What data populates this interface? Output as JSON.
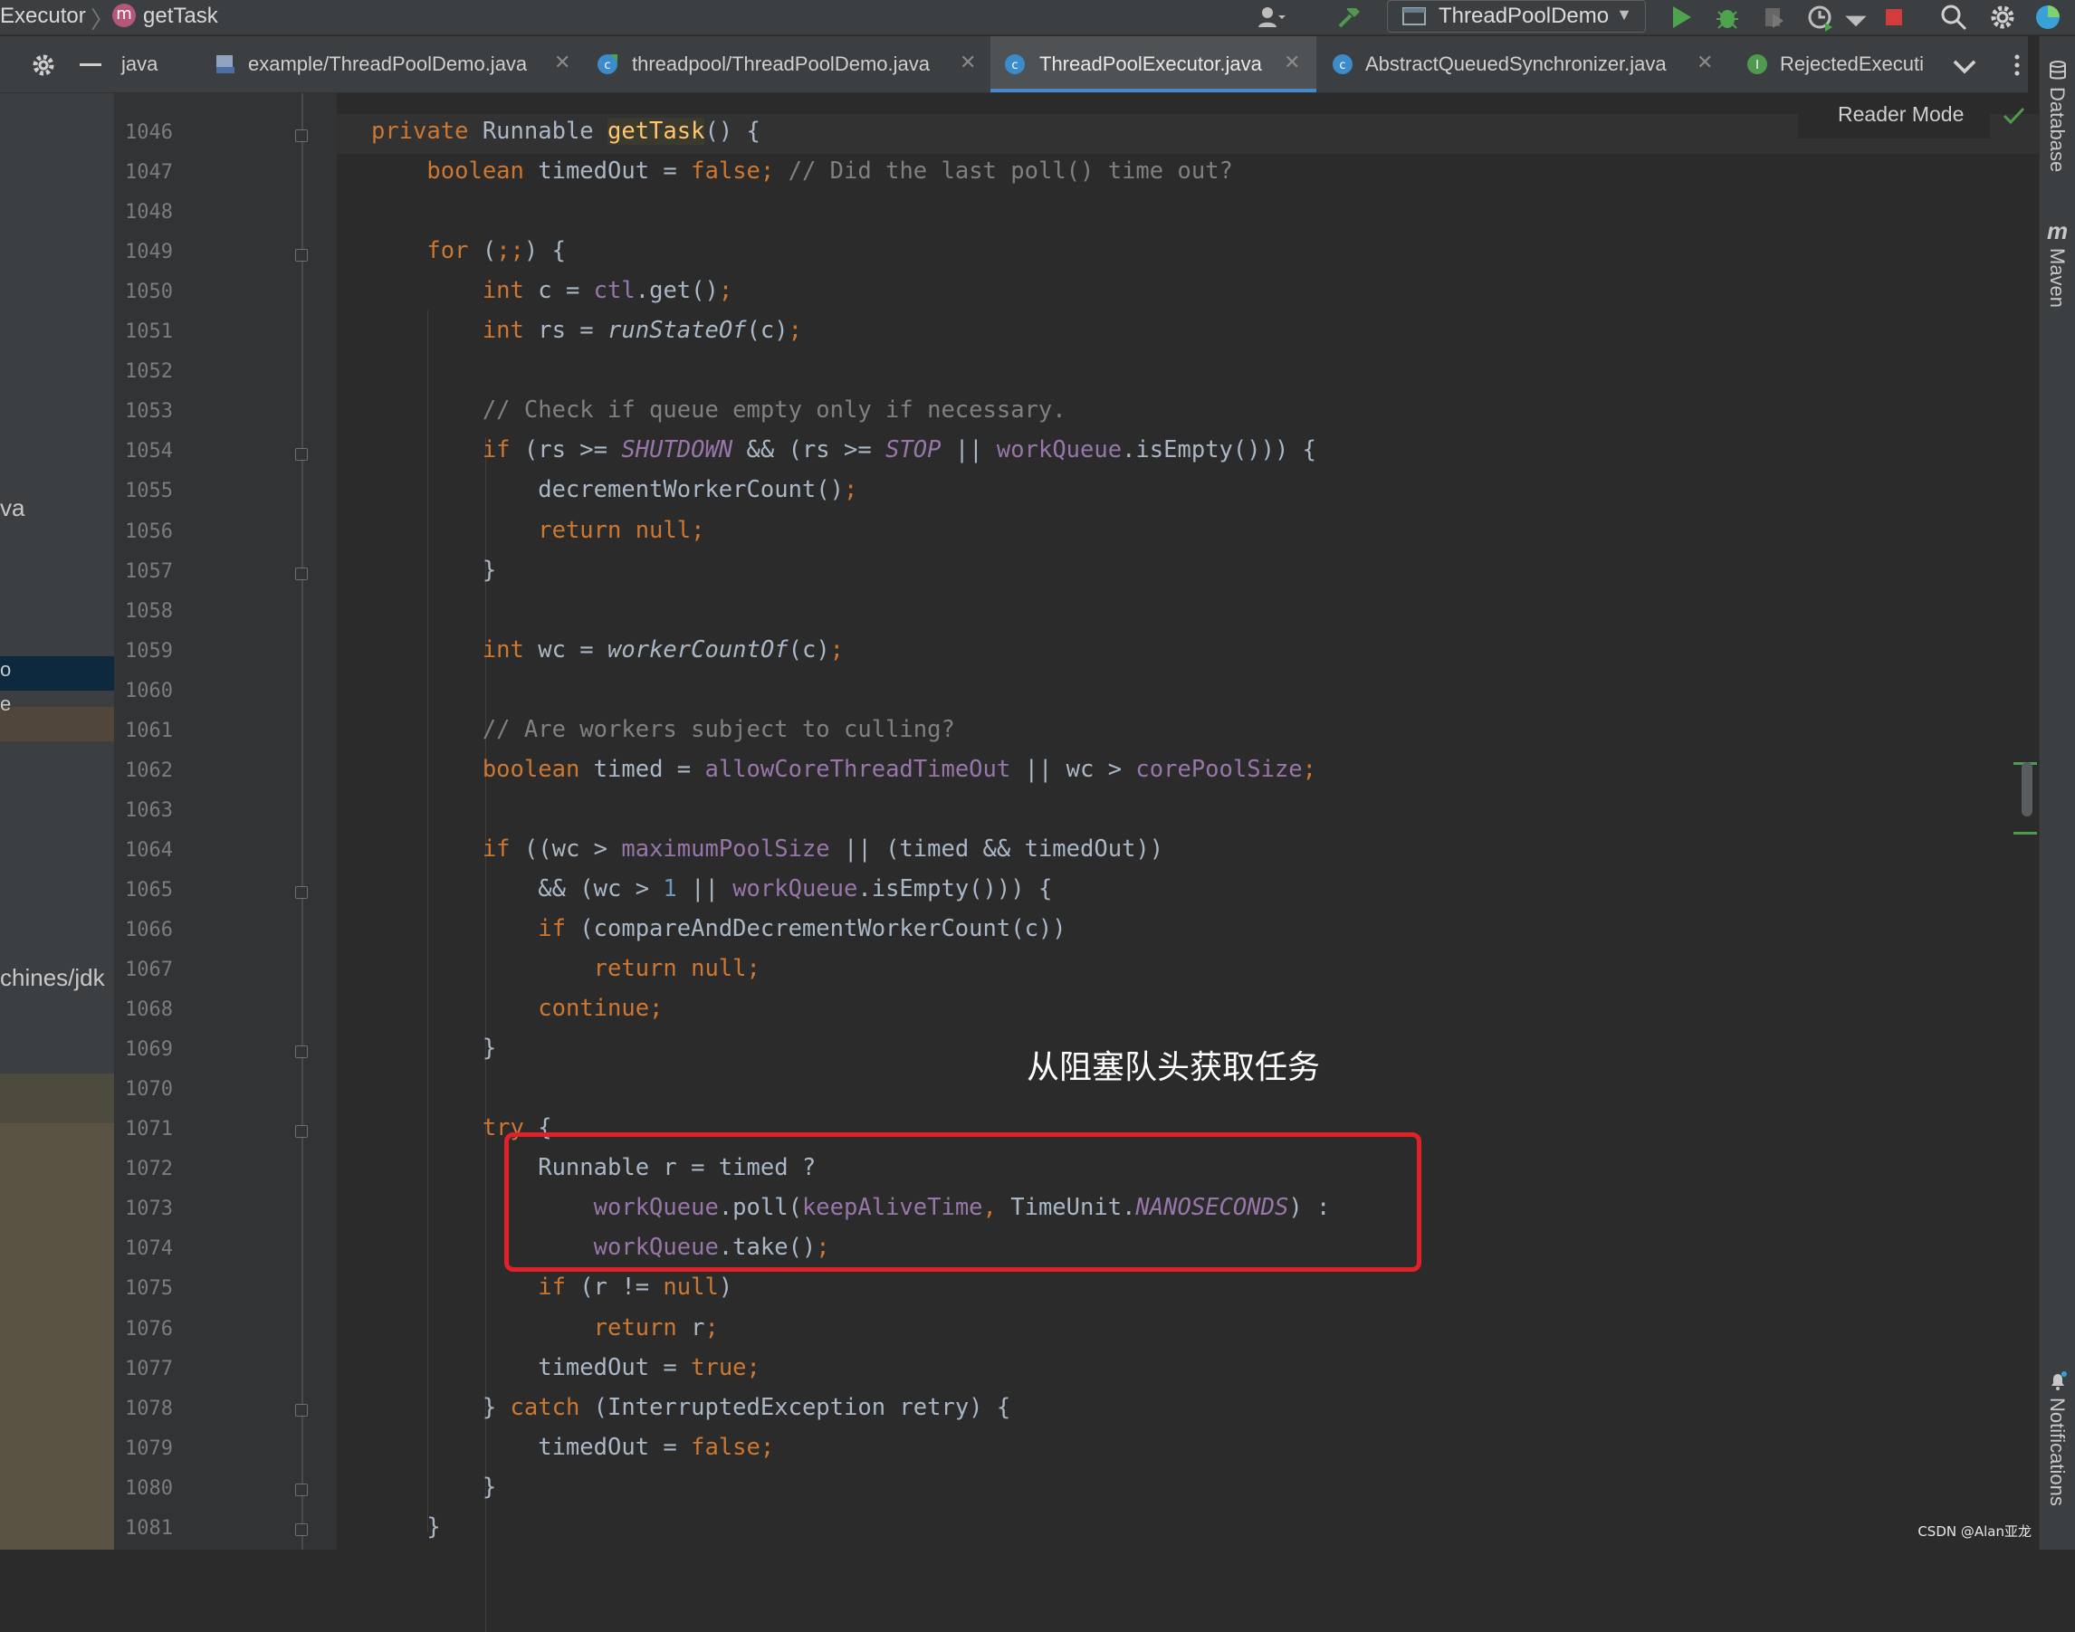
{
  "breadcrumb": {
    "class_name": "Executor",
    "method_badge": "m",
    "method_name": "getTask"
  },
  "toolbar": {
    "run_config": "ThreadPoolDemo"
  },
  "tabs": [
    {
      "label": "java"
    },
    {
      "label": "example/ThreadPoolDemo.java"
    },
    {
      "label": "threadpool/ThreadPoolDemo.java"
    },
    {
      "label": "ThreadPoolExecutor.java"
    },
    {
      "label": "AbstractQueuedSynchronizer.java"
    },
    {
      "label": "RejectedExecuti"
    }
  ],
  "active_tab": "ThreadPoolExecutor.java",
  "reader_mode": "Reader Mode",
  "left_panel": {
    "row1": "va",
    "row2": "o",
    "row3": "e",
    "row4": "chines/jdk"
  },
  "right_tools": {
    "database": "Database",
    "maven": "Maven",
    "notifications": "Notifications"
  },
  "annotation": "从阻塞队头获取任务",
  "watermark": "CSDN @Alan亚龙",
  "colors": {
    "keyword": "#cc7832",
    "field": "#9876aa",
    "method_decl": "#ffc66d",
    "comment": "#808080",
    "number": "#6897bb",
    "highlight_box": "#e0212a",
    "active_tab_underline": "#4a88c7"
  },
  "code": {
    "line_numbers": [
      "1046",
      "1047",
      "1048",
      "1049",
      "1050",
      "1051",
      "1052",
      "1053",
      "1054",
      "1055",
      "1056",
      "1057",
      "1058",
      "1059",
      "1060",
      "1061",
      "1062",
      "1063",
      "1064",
      "1065",
      "1066",
      "1067",
      "1068",
      "1069",
      "1070",
      "1071",
      "1072",
      "1073",
      "1074",
      "1075",
      "1076",
      "1077",
      "1078",
      "1079",
      "1080",
      "1081"
    ],
    "lines": [
      [
        {
          "t": "",
          "c": ""
        },
        {
          "t": "private ",
          "c": "kw"
        },
        {
          "t": "Runnable ",
          "c": ""
        },
        {
          "t": "getTask",
          "c": "meth"
        },
        {
          "t": "() {",
          "c": ""
        }
      ],
      [
        {
          "t": "    ",
          "c": ""
        },
        {
          "t": "boolean ",
          "c": "kw"
        },
        {
          "t": "timedOut = ",
          "c": ""
        },
        {
          "t": "false",
          "c": "kw"
        },
        {
          "t": "; ",
          "c": "kw"
        },
        {
          "t": "// Did the last poll() time out?",
          "c": "cmt"
        }
      ],
      [],
      [
        {
          "t": "    ",
          "c": ""
        },
        {
          "t": "for ",
          "c": "kw"
        },
        {
          "t": "(",
          "c": ""
        },
        {
          "t": ";;",
          "c": "kw"
        },
        {
          "t": ") {",
          "c": ""
        }
      ],
      [
        {
          "t": "        ",
          "c": ""
        },
        {
          "t": "int ",
          "c": "kw"
        },
        {
          "t": "c = ",
          "c": ""
        },
        {
          "t": "ctl",
          "c": "fld"
        },
        {
          "t": ".get()",
          "c": ""
        },
        {
          "t": ";",
          "c": "kw"
        }
      ],
      [
        {
          "t": "        ",
          "c": ""
        },
        {
          "t": "int ",
          "c": "kw"
        },
        {
          "t": "rs = ",
          "c": ""
        },
        {
          "t": "runStateOf",
          "c": "ital"
        },
        {
          "t": "(c)",
          "c": ""
        },
        {
          "t": ";",
          "c": "kw"
        }
      ],
      [],
      [
        {
          "t": "        ",
          "c": ""
        },
        {
          "t": "// Check if queue empty only if necessary.",
          "c": "cmt"
        }
      ],
      [
        {
          "t": "        ",
          "c": ""
        },
        {
          "t": "if ",
          "c": "kw"
        },
        {
          "t": "(rs >= ",
          "c": ""
        },
        {
          "t": "SHUTDOWN",
          "c": "cst"
        },
        {
          "t": " && (rs >= ",
          "c": ""
        },
        {
          "t": "STOP",
          "c": "cst"
        },
        {
          "t": " || ",
          "c": ""
        },
        {
          "t": "workQueue",
          "c": "fld"
        },
        {
          "t": ".isEmpty())) {",
          "c": ""
        }
      ],
      [
        {
          "t": "            decrementWorkerCount()",
          "c": ""
        },
        {
          "t": ";",
          "c": "kw"
        }
      ],
      [
        {
          "t": "            ",
          "c": ""
        },
        {
          "t": "return null;",
          "c": "kw"
        }
      ],
      [
        {
          "t": "        }",
          "c": ""
        }
      ],
      [],
      [
        {
          "t": "        ",
          "c": ""
        },
        {
          "t": "int ",
          "c": "kw"
        },
        {
          "t": "wc = ",
          "c": ""
        },
        {
          "t": "workerCountOf",
          "c": "ital"
        },
        {
          "t": "(c)",
          "c": ""
        },
        {
          "t": ";",
          "c": "kw"
        }
      ],
      [],
      [
        {
          "t": "        ",
          "c": ""
        },
        {
          "t": "// Are workers subject to culling?",
          "c": "cmt"
        }
      ],
      [
        {
          "t": "        ",
          "c": ""
        },
        {
          "t": "boolean ",
          "c": "kw"
        },
        {
          "t": "timed = ",
          "c": ""
        },
        {
          "t": "allowCoreThreadTimeOut",
          "c": "fld"
        },
        {
          "t": " || wc > ",
          "c": ""
        },
        {
          "t": "corePoolSize",
          "c": "fld"
        },
        {
          "t": ";",
          "c": "kw"
        }
      ],
      [],
      [
        {
          "t": "        ",
          "c": ""
        },
        {
          "t": "if ",
          "c": "kw"
        },
        {
          "t": "((wc > ",
          "c": ""
        },
        {
          "t": "maximumPoolSize",
          "c": "fld"
        },
        {
          "t": " || (timed && timedOut))",
          "c": ""
        }
      ],
      [
        {
          "t": "            && (wc > ",
          "c": ""
        },
        {
          "t": "1",
          "c": "num"
        },
        {
          "t": " || ",
          "c": ""
        },
        {
          "t": "workQueue",
          "c": "fld"
        },
        {
          "t": ".isEmpty())) {",
          "c": ""
        }
      ],
      [
        {
          "t": "            ",
          "c": ""
        },
        {
          "t": "if ",
          "c": "kw"
        },
        {
          "t": "(compareAndDecrementWorkerCount(c))",
          "c": ""
        }
      ],
      [
        {
          "t": "                ",
          "c": ""
        },
        {
          "t": "return null;",
          "c": "kw"
        }
      ],
      [
        {
          "t": "            ",
          "c": ""
        },
        {
          "t": "continue;",
          "c": "kw"
        }
      ],
      [
        {
          "t": "        }",
          "c": ""
        }
      ],
      [],
      [
        {
          "t": "        ",
          "c": ""
        },
        {
          "t": "try ",
          "c": "kw"
        },
        {
          "t": "{",
          "c": ""
        }
      ],
      [
        {
          "t": "            Runnable r = timed ?",
          "c": ""
        }
      ],
      [
        {
          "t": "                ",
          "c": ""
        },
        {
          "t": "workQueue",
          "c": "fld"
        },
        {
          "t": ".poll(",
          "c": ""
        },
        {
          "t": "keepAliveTime",
          "c": "fld"
        },
        {
          "t": ", ",
          "c": "kw"
        },
        {
          "t": "TimeUnit.",
          "c": ""
        },
        {
          "t": "NANOSECONDS",
          "c": "cst"
        },
        {
          "t": ") :",
          "c": ""
        }
      ],
      [
        {
          "t": "                ",
          "c": ""
        },
        {
          "t": "workQueue",
          "c": "fld"
        },
        {
          "t": ".take()",
          "c": ""
        },
        {
          "t": ";",
          "c": "kw"
        }
      ],
      [
        {
          "t": "            ",
          "c": ""
        },
        {
          "t": "if ",
          "c": "kw"
        },
        {
          "t": "(r != ",
          "c": ""
        },
        {
          "t": "null",
          "c": "kw"
        },
        {
          "t": ")",
          "c": ""
        }
      ],
      [
        {
          "t": "                ",
          "c": ""
        },
        {
          "t": "return ",
          "c": "kw"
        },
        {
          "t": "r",
          "c": ""
        },
        {
          "t": ";",
          "c": "kw"
        }
      ],
      [
        {
          "t": "            timedOut = ",
          "c": ""
        },
        {
          "t": "true;",
          "c": "kw"
        }
      ],
      [
        {
          "t": "        } ",
          "c": ""
        },
        {
          "t": "catch ",
          "c": "kw"
        },
        {
          "t": "(InterruptedException retry) {",
          "c": ""
        }
      ],
      [
        {
          "t": "            timedOut = ",
          "c": ""
        },
        {
          "t": "false;",
          "c": "kw"
        }
      ],
      [
        {
          "t": "        }",
          "c": ""
        }
      ],
      [
        {
          "t": "    }",
          "c": ""
        }
      ]
    ]
  }
}
